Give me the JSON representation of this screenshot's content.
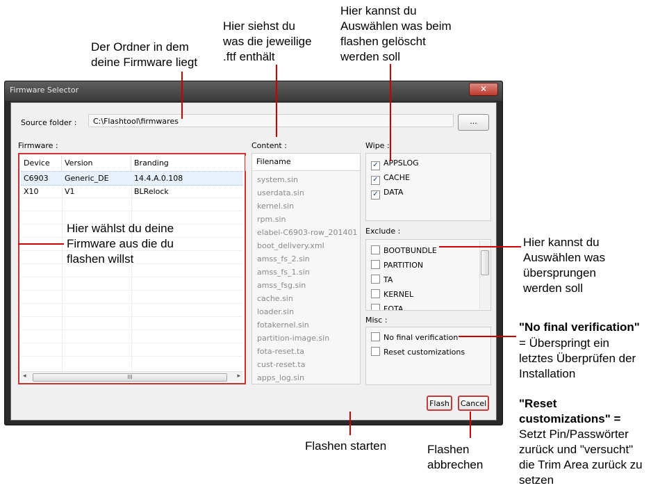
{
  "annotations": {
    "source_folder": "Der Ordner in dem\ndeine Firmware liegt",
    "content": "Hier siehst du\nwas die jeweilige\n.ftf enthält",
    "wipe": "Hier kannst du\nAuswählen was beim\nflashen gelöscht\nwerden soll",
    "firmware": "Hier wählst du deine\nFirmware aus die du\nflashen willst",
    "exclude": "Hier kannst du\nAuswählen was\nübersprungen\nwerden soll",
    "no_final_title": "\"No final verification\"",
    "no_final_text": "= Überspringt ein\nletztes Überprüfen der\nInstallation",
    "reset_title": "\"Reset\ncustomizations\" =",
    "reset_text": "Setzt Pin/Passwörter\nzurück und \"versucht\"\ndie Trim Area zurück zu\nsetzen",
    "flash": "Flashen starten",
    "cancel": "Flashen\nabbrechen"
  },
  "window": {
    "title": "Firmware Selector",
    "close": "✕",
    "source_label": "Source folder :",
    "source_value": "C:\\Flashtool\\firmwares",
    "browse": "...",
    "firmware_label": "Firmware :",
    "content_label": "Content :",
    "wipe_label": "Wipe :",
    "exclude_label": "Exclude :",
    "misc_label": "Misc :"
  },
  "firmware_table": {
    "columns": [
      "Device",
      "Version",
      "Branding"
    ],
    "rows": [
      [
        "C6903",
        "Generic_DE",
        "14.4.A.0.108"
      ],
      [
        "X10",
        "V1",
        "BLRelock"
      ]
    ],
    "scroll_thumb": "III",
    "scroll_left": "◂",
    "scroll_right": "▸"
  },
  "content": {
    "header": "Filename",
    "items": [
      "system.sin",
      "userdata.sin",
      "kernel.sin",
      "rpm.sin",
      "elabel-C6903-row_201401",
      "boot_delivery.xml",
      "amss_fs_2.sin",
      "amss_fs_1.sin",
      "amss_fsg.sin",
      "cache.sin",
      "loader.sin",
      "fotakernel.sin",
      "partition-image.sin",
      "fota-reset.ta",
      "cust-reset.ta",
      "apps_log.sin"
    ]
  },
  "wipe": [
    {
      "label": "APPSLOG",
      "checked": "✓"
    },
    {
      "label": "CACHE",
      "checked": "✓"
    },
    {
      "label": "DATA",
      "checked": "✓"
    }
  ],
  "exclude": [
    "BOOTBUNDLE",
    "PARTITION",
    "TA",
    "KERNEL",
    "FOTA"
  ],
  "misc": [
    "No final verification",
    "Reset customizations"
  ],
  "buttons": {
    "flash": "Flash",
    "cancel": "Cancel"
  },
  "accent_color": "#cc0000"
}
